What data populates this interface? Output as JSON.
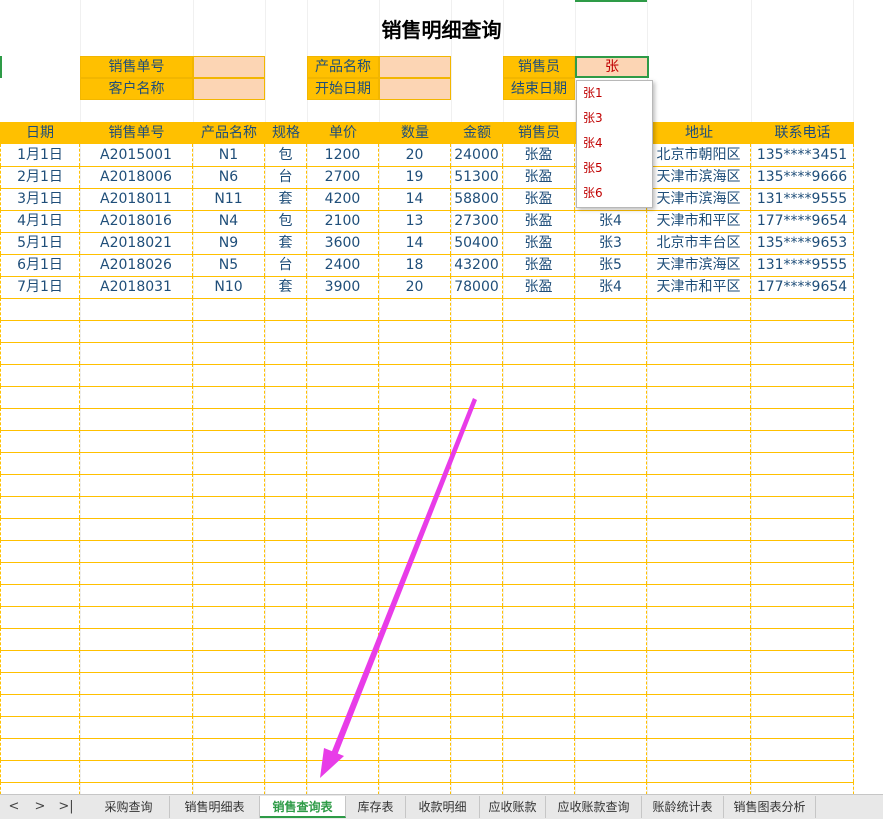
{
  "title": "销售明细查询",
  "filters": {
    "sales_no_label": "销售单号",
    "customer_label": "客户名称",
    "product_label": "产品名称",
    "start_date_label": "开始日期",
    "salesperson_label": "销售员",
    "end_date_label": "结束日期",
    "salesperson_value": "张",
    "sales_no_value": "",
    "customer_value": "",
    "product_value": "",
    "start_date_value": ""
  },
  "dropdown": {
    "options": [
      "张1",
      "张3",
      "张4",
      "张5",
      "张6"
    ]
  },
  "table": {
    "headers": [
      "日期",
      "销售单号",
      "产品名称",
      "规格",
      "单价",
      "数量",
      "金额",
      "销售员",
      "",
      "地址",
      "联系电话"
    ],
    "rows": [
      [
        "1月1日",
        "A2015001",
        "N1",
        "包",
        "1200",
        "20",
        "24000",
        "张盈",
        "",
        "北京市朝阳区",
        "135****3451"
      ],
      [
        "2月1日",
        "A2018006",
        "N6",
        "台",
        "2700",
        "19",
        "51300",
        "张盈",
        "",
        "天津市滨海区",
        "135****9666"
      ],
      [
        "3月1日",
        "A2018011",
        "N11",
        "套",
        "4200",
        "14",
        "58800",
        "张盈",
        "",
        "天津市滨海区",
        "131****9555"
      ],
      [
        "4月1日",
        "A2018016",
        "N4",
        "包",
        "2100",
        "13",
        "27300",
        "张盈",
        "张4",
        "天津市和平区",
        "177****9654"
      ],
      [
        "5月1日",
        "A2018021",
        "N9",
        "套",
        "3600",
        "14",
        "50400",
        "张盈",
        "张3",
        "北京市丰台区",
        "135****9653"
      ],
      [
        "6月1日",
        "A2018026",
        "N5",
        "台",
        "2400",
        "18",
        "43200",
        "张盈",
        "张5",
        "天津市滨海区",
        "131****9555"
      ],
      [
        "7月1日",
        "A2018031",
        "N10",
        "套",
        "3900",
        "20",
        "78000",
        "张盈",
        "张4",
        "天津市和平区",
        "177****9654"
      ]
    ]
  },
  "sheet_nav": {
    "prev": "<",
    "next": ">",
    "last": ">|"
  },
  "sheet_tabs": [
    {
      "label": "采购查询",
      "active": false
    },
    {
      "label": "销售明细表",
      "active": false
    },
    {
      "label": "销售查询表",
      "active": true
    },
    {
      "label": "库存表",
      "active": false
    },
    {
      "label": "收款明细",
      "active": false
    },
    {
      "label": "应收账款",
      "active": false
    },
    {
      "label": "应收账款查询",
      "active": false
    },
    {
      "label": "账龄统计表",
      "active": false
    },
    {
      "label": "销售图表分析",
      "active": false
    }
  ],
  "colors": {
    "header_fill": "#ffc000",
    "input_fill": "#fcd5b4",
    "text_blue": "#1f4e79",
    "accent_green": "#2e9b47",
    "arrow": "#e83ce8"
  }
}
